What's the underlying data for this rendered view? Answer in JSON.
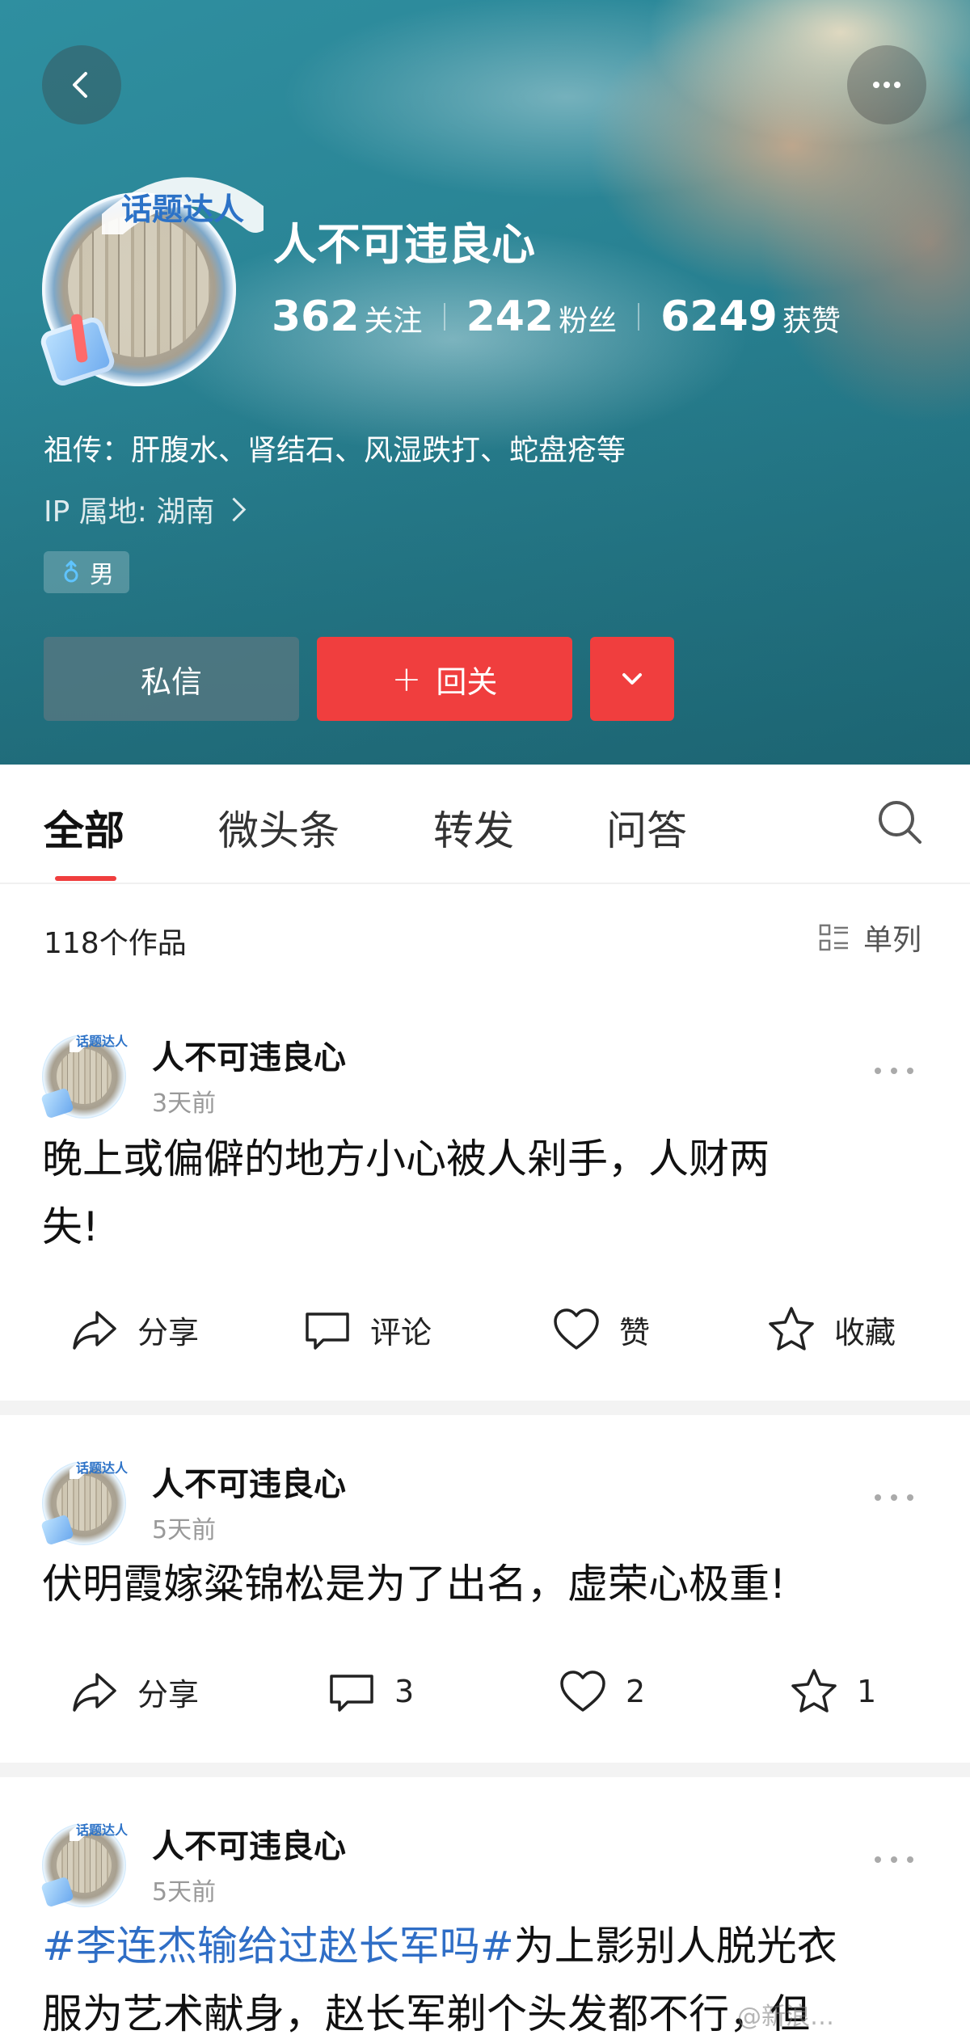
{
  "profile": {
    "name": "人不可违良心",
    "badge": "话题达人",
    "stats": [
      {
        "value": "362",
        "label": "关注"
      },
      {
        "value": "242",
        "label": "粉丝"
      },
      {
        "value": "6249",
        "label": "获赞"
      }
    ],
    "bio": "祖传：肝腹水、肾结石、风湿跌打、蛇盘疮等",
    "ip": "IP 属地: 湖南",
    "gender": "男",
    "buttons": {
      "message": "私信",
      "follow_back": "回关"
    }
  },
  "tabs": [
    {
      "label": "全部",
      "active": true
    },
    {
      "label": "微头条",
      "active": false
    },
    {
      "label": "转发",
      "active": false
    },
    {
      "label": "问答",
      "active": false
    }
  ],
  "content": {
    "count": "118个作品",
    "layout_toggle": "单列"
  },
  "posts": [
    {
      "author": "人不可违良心",
      "time": "3天前",
      "text_line1": "晚上或偏僻的地方小心被人剁手，人财两",
      "text_line2": "失!",
      "share": "分享",
      "comment": "评论",
      "like": "赞",
      "favorite": "收藏"
    },
    {
      "author": "人不可违良心",
      "time": "5天前",
      "text_line1": "伏明霞嫁粱锦松是为了出名，虚荣心极重!",
      "share": "分享",
      "comment": "3",
      "like": "2",
      "favorite": "1"
    },
    {
      "author": "人不可违良心",
      "time": "5天前",
      "hashtag": "#李连杰输给过赵长军吗#",
      "text_line1_rest": "为上影别人脱光衣",
      "text_line2": "服为艺术献身，赵长军剃个头发都不行，但"
    }
  ],
  "watermark": "@新浪…",
  "colors": {
    "accent_red": "#f03e3e",
    "hashtag_blue": "#2f6ec6",
    "banner_teal": "#2a8596"
  }
}
